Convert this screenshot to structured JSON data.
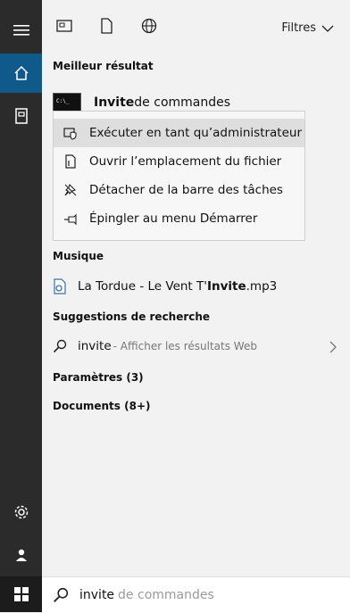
{
  "topbar": {
    "filters_label": "Filtres"
  },
  "sections": {
    "best": "Meilleur résultat",
    "music": "Musique",
    "suggestions": "Suggestions de recherche",
    "settings": "Paramètres (3)",
    "documents": "Documents (8+)"
  },
  "best_result": {
    "bold": "Invite",
    "rest": " de commandes"
  },
  "context_menu": [
    {
      "label": "Exécuter en tant qu’administrateur",
      "icon": "admin-shield-icon",
      "highlighted": true
    },
    {
      "label": "Ouvrir l’emplacement du fichier",
      "icon": "file-location-icon",
      "highlighted": false
    },
    {
      "label": "Détacher de la barre des tâches",
      "icon": "unpin-icon",
      "highlighted": false
    },
    {
      "label": "Épingler au menu Démarrer",
      "icon": "pin-icon",
      "highlighted": false
    }
  ],
  "music_item": {
    "prefix": "La Tordue - Le Vent T'",
    "bold": "Invite",
    "suffix": ".mp3"
  },
  "web_suggestion": {
    "query": "invite",
    "hint": " - Afficher les résultats Web"
  },
  "search_box": {
    "query": "invite",
    "completion": "de commandes"
  }
}
